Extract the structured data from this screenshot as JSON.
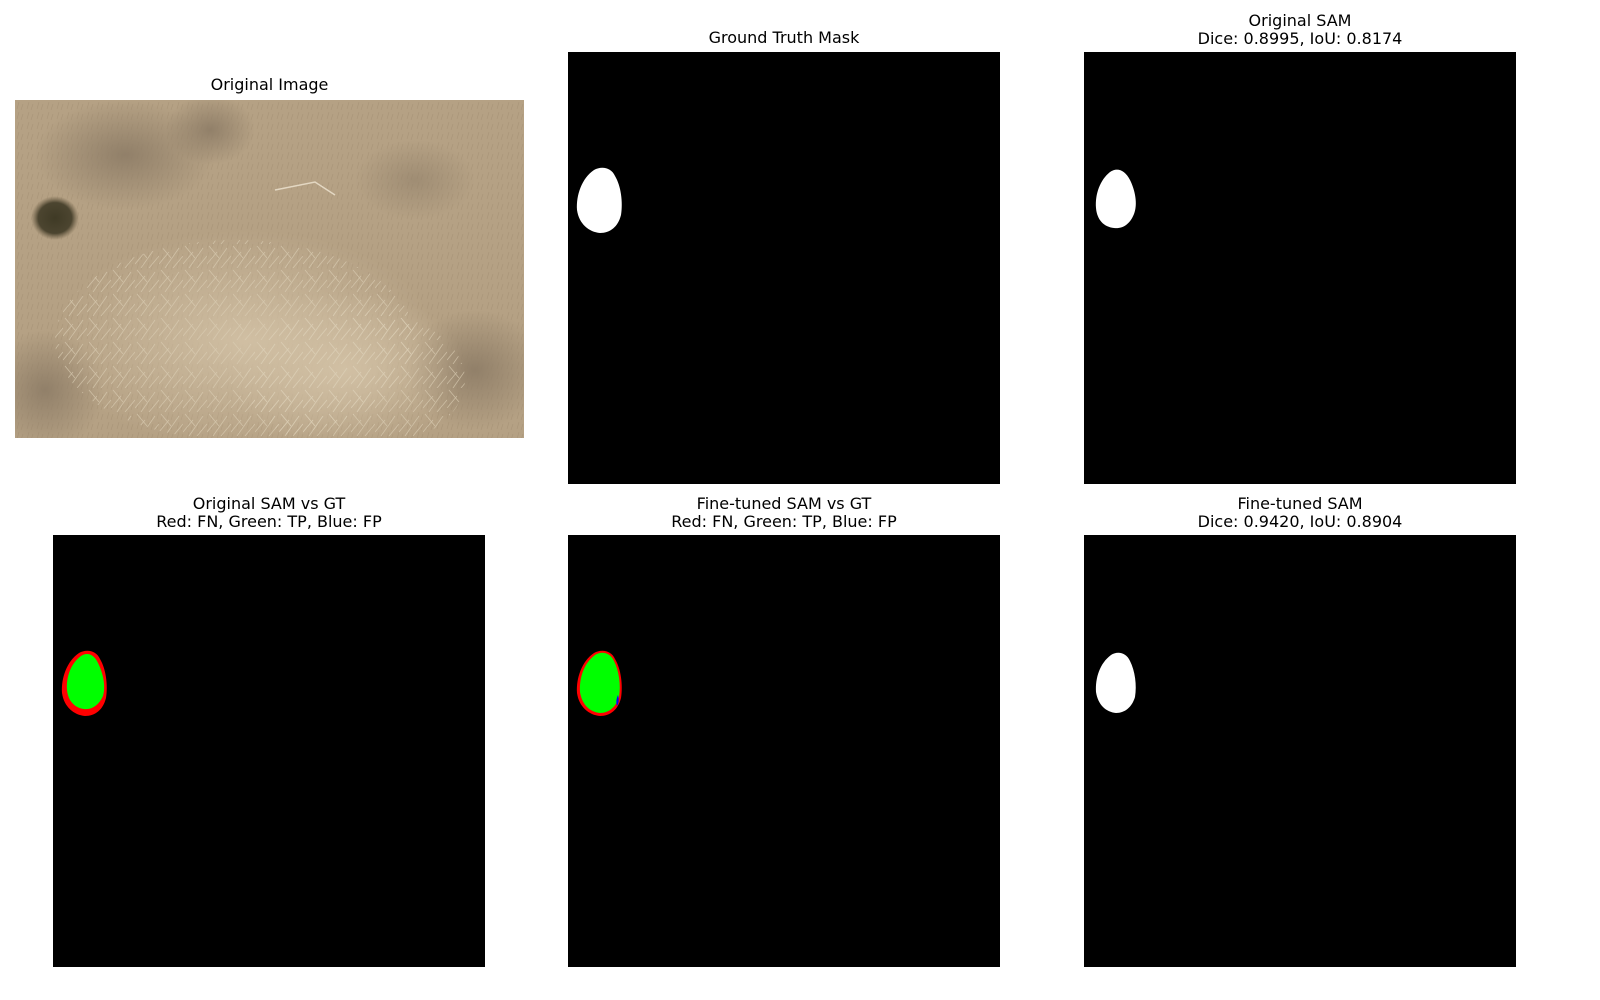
{
  "panels": {
    "original_image": {
      "title": "Original Image"
    },
    "ground_truth": {
      "title": "Ground Truth Mask"
    },
    "original_sam": {
      "title": "Original SAM",
      "subtitle": "Dice: 0.8995, IoU: 0.8174"
    },
    "original_vs_gt": {
      "title": "Original SAM vs GT",
      "subtitle": "Red: FN, Green: TP, Blue: FP"
    },
    "finetuned_vs_gt": {
      "title": "Fine-tuned SAM vs GT",
      "subtitle": "Red: FN, Green: TP, Blue: FP"
    },
    "finetuned_sam": {
      "title": "Fine-tuned SAM",
      "subtitle": "Dice: 0.9420, IoU: 0.8904"
    }
  },
  "colors": {
    "background": "#ffffff",
    "mask_background": "#000000",
    "mask_foreground": "#ffffff",
    "false_negative": "#ff0000",
    "true_positive": "#00ff00",
    "false_positive": "#0000ff",
    "terrain_base": "#b5a184"
  },
  "icons": {
    "photo": "aerial-terrain-photo",
    "mask": "segmentation-mask-blob"
  }
}
